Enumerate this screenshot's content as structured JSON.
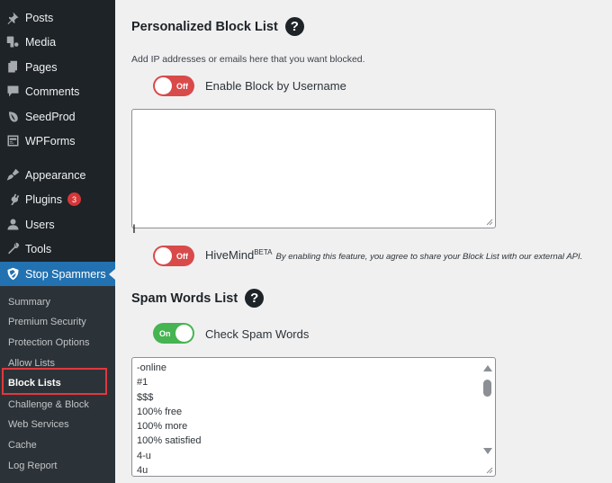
{
  "sidebar": {
    "items": [
      {
        "label": "Posts",
        "icon": "pin-icon"
      },
      {
        "label": "Media",
        "icon": "media-icon"
      },
      {
        "label": "Pages",
        "icon": "pages-icon"
      },
      {
        "label": "Comments",
        "icon": "comment-icon"
      },
      {
        "label": "SeedProd",
        "icon": "leaf-icon"
      },
      {
        "label": "WPForms",
        "icon": "form-icon"
      },
      {
        "label": "Appearance",
        "icon": "brush-icon"
      },
      {
        "label": "Plugins",
        "icon": "plug-icon",
        "badge": "3"
      },
      {
        "label": "Users",
        "icon": "user-icon"
      },
      {
        "label": "Tools",
        "icon": "wrench-icon"
      },
      {
        "label": "Stop Spammers",
        "icon": "shield-icon",
        "active": true
      }
    ],
    "submenu": [
      {
        "label": "Summary"
      },
      {
        "label": "Premium Security"
      },
      {
        "label": "Protection Options"
      },
      {
        "label": "Allow Lists"
      },
      {
        "label": "Block Lists",
        "current": true
      },
      {
        "label": "Challenge & Block"
      },
      {
        "label": "Web Services"
      },
      {
        "label": "Cache"
      },
      {
        "label": "Log Report"
      }
    ]
  },
  "block_list": {
    "title": "Personalized Block List",
    "help": "?",
    "description": "Add IP addresses or emails here that you want blocked.",
    "username_toggle": {
      "state": "Off",
      "label": "Enable Block by Username"
    },
    "textarea_value": "",
    "hivemind": {
      "state": "Off",
      "name": "HiveMind",
      "sup": "BETA",
      "note": "By enabling this feature, you agree to share your Block List with our external API."
    }
  },
  "spam_words": {
    "title": "Spam Words List",
    "help": "?",
    "toggle": {
      "state": "On",
      "label": "Check Spam Words"
    },
    "words": [
      "-online",
      "#1",
      "$$$",
      "100% free",
      "100% more",
      "100% satisfied",
      "4-u",
      "4u"
    ]
  },
  "colors": {
    "sidebar_bg": "#1d2327",
    "accent": "#2271b1",
    "toggle_off": "#d94a4a",
    "toggle_on": "#46b450",
    "badge": "#d63638",
    "highlight": "#e0393e"
  }
}
